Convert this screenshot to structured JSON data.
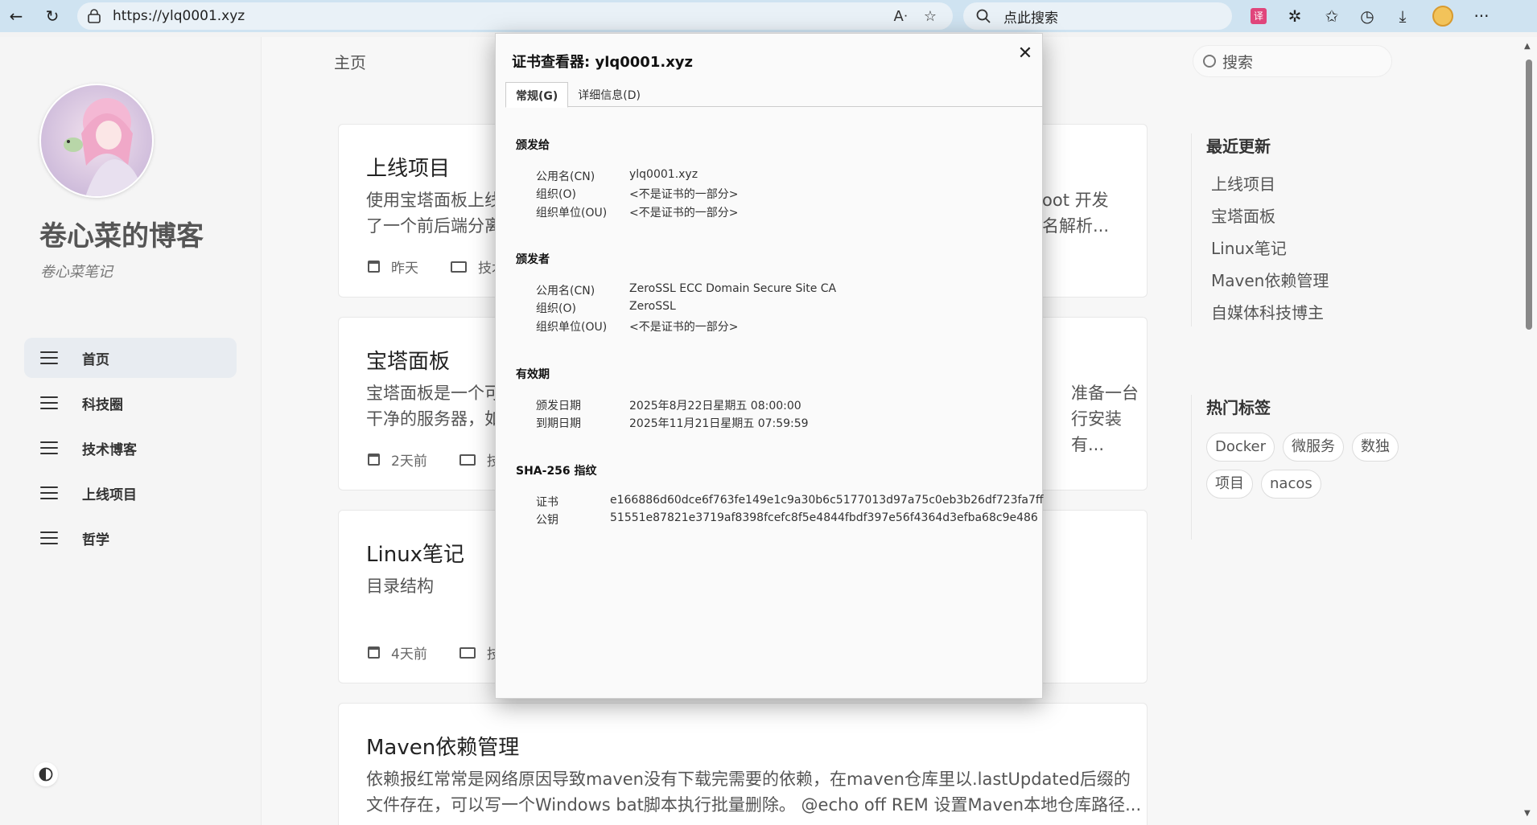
{
  "browser": {
    "url": "https://ylq0001.xyz",
    "search_placeholder": "点此搜索"
  },
  "sidebar": {
    "site_title": "卷心菜的博客",
    "site_subtitle": "卷心菜笔记",
    "nav": [
      {
        "label": "首页",
        "active": true
      },
      {
        "label": "科技圈",
        "active": false
      },
      {
        "label": "技术博客",
        "active": false
      },
      {
        "label": "上线项目",
        "active": false
      },
      {
        "label": "哲学",
        "active": false
      }
    ]
  },
  "main": {
    "breadcrumb": "主页",
    "search_placeholder": "搜索",
    "posts": [
      {
        "title": "上线项目",
        "excerpt_left_1": "使用宝塔面板上线",
        "excerpt_left_2": "了一个前后端分离",
        "excerpt_right_1": "oot 开发",
        "excerpt_right_2": "名解析...",
        "date": "昨天",
        "category": "技术"
      },
      {
        "title": "宝塔面板",
        "excerpt_left_1": "宝塔面板是一个可",
        "excerpt_left_2": "干净的服务器，如",
        "excerpt_right_1": "准备一台",
        "excerpt_right_2": "行安装有...",
        "date": "2天前",
        "category": "技"
      },
      {
        "title": "Linux笔记",
        "excerpt": "目录结构",
        "date": "4天前",
        "category": "技"
      },
      {
        "title": "Maven依赖管理",
        "excerpt_1": "依赖报红常常是网络原因导致maven没有下载完需要的依赖，在maven仓库里以.lastUpdated后缀的",
        "excerpt_2": "文件存在，可以写一个Windows bat脚本执行批量删除。 @echo off REM 设置Maven本地仓库路径..."
      }
    ]
  },
  "right_sidebar": {
    "recent_title": "最近更新",
    "recent": [
      "上线项目",
      "宝塔面板",
      "Linux笔记",
      "Maven依赖管理",
      "自媒体科技博主"
    ],
    "tags_title": "热门标签",
    "tags": [
      "Docker",
      "微服务",
      "数独",
      "项目",
      "nacos"
    ]
  },
  "dialog": {
    "title": "证书查看器: ylq0001.xyz",
    "tabs": [
      "常规(G)",
      "详细信息(D)"
    ],
    "issued_to": {
      "heading": "颁发给",
      "rows": [
        {
          "k": "公用名(CN)",
          "v": "ylq0001.xyz"
        },
        {
          "k": "组织(O)",
          "v": "<不是证书的一部分>"
        },
        {
          "k": "组织单位(OU)",
          "v": "<不是证书的一部分>"
        }
      ]
    },
    "issued_by": {
      "heading": "颁发者",
      "rows": [
        {
          "k": "公用名(CN)",
          "v": "ZeroSSL ECC Domain Secure Site CA"
        },
        {
          "k": "组织(O)",
          "v": "ZeroSSL"
        },
        {
          "k": "组织单位(OU)",
          "v": "<不是证书的一部分>"
        }
      ]
    },
    "validity": {
      "heading": "有效期",
      "rows": [
        {
          "k": "颁发日期",
          "v": "2025年8月22日星期五 08:00:00"
        },
        {
          "k": "到期日期",
          "v": "2025年11月21日星期五 07:59:59"
        }
      ]
    },
    "fingerprints": {
      "heading": "SHA-256 指纹",
      "rows": [
        {
          "k": "证书",
          "v": "e166886d60dce6f763fe149e1c9a30b6c5177013d97a75c0eb3b26df723fa7ff"
        },
        {
          "k": "公钥",
          "v": "51551e87821e3719af8398fcefc8f5e4844fbdf397e56f4364d3efba68c9e486"
        }
      ]
    }
  }
}
